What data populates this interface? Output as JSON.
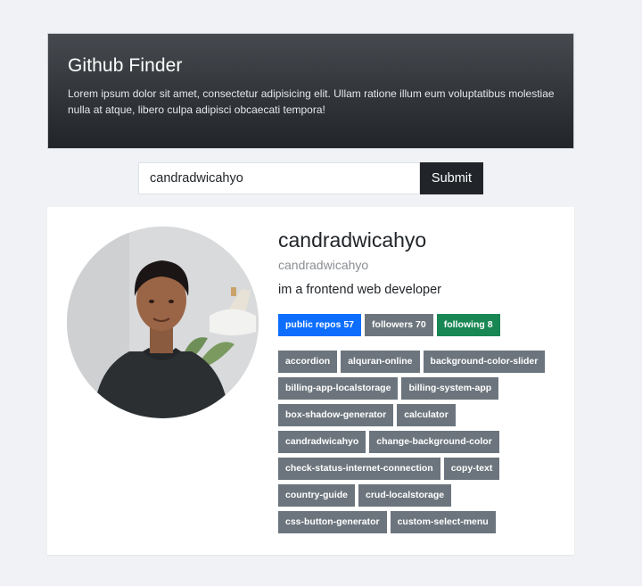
{
  "header": {
    "title": "Github Finder",
    "description": "Lorem ipsum dolor sit amet, consectetur adipisicing elit. Ullam ratione illum eum voluptatibus molestiae nulla at atque, libero culpa adipisci obcaecati tempora!"
  },
  "search": {
    "value": "candradwicahyo",
    "submit_label": "Submit"
  },
  "profile": {
    "name": "candradwicahyo",
    "login": "candradwicahyo",
    "bio": "im a frontend web developer",
    "stats": {
      "public_repos": "public repos 57",
      "followers": "followers 70",
      "following": "following 8"
    },
    "repos": [
      "accordion",
      "alquran-online",
      "background-color-slider",
      "billing-app-localstorage",
      "billing-system-app",
      "box-shadow-generator",
      "calculator",
      "candradwicahyo",
      "change-background-color",
      "check-status-internet-connection",
      "copy-text",
      "country-guide",
      "crud-localstorage",
      "css-button-generator",
      "custom-select-menu"
    ]
  },
  "colors": {
    "primary": "#0d6efd",
    "secondary": "#6c757d",
    "success": "#198754",
    "dark": "#212529"
  }
}
